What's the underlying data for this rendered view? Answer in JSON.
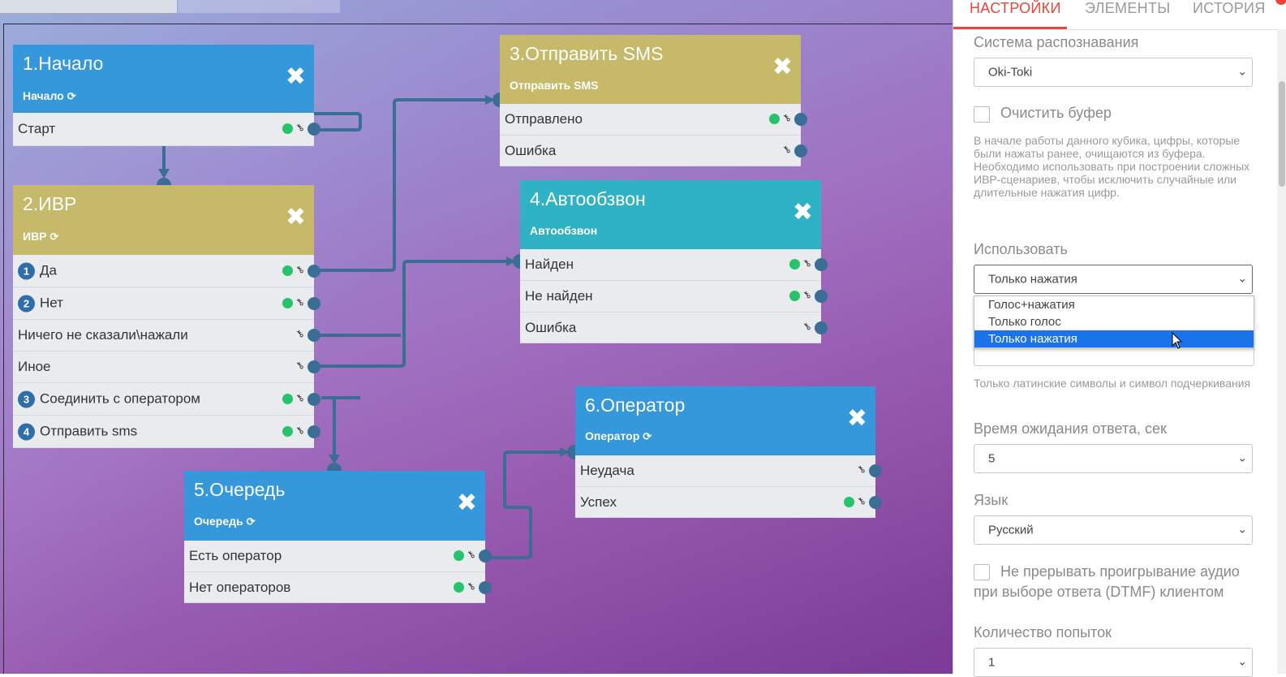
{
  "nodes": {
    "n1": {
      "title": "1.Начало",
      "subtitle": "Начало",
      "rows": [
        {
          "label": "Старт"
        }
      ]
    },
    "n2": {
      "title": "2.ИВР",
      "subtitle": "ИВР",
      "rows": [
        {
          "num": "1",
          "label": "Да"
        },
        {
          "num": "2",
          "label": "Нет"
        },
        {
          "label": "Ничего не сказали\\нажали"
        },
        {
          "label": "Иное"
        },
        {
          "num": "3",
          "label": "Соединить с оператором"
        },
        {
          "num": "4",
          "label": "Отправить sms"
        }
      ]
    },
    "n3": {
      "title": "3.Отправить SMS",
      "subtitle": "Отправить SMS",
      "rows": [
        {
          "label": "Отправлено"
        },
        {
          "label": "Ошибка"
        }
      ]
    },
    "n4": {
      "title": "4.Автообзвон",
      "subtitle": "Автообзвон",
      "rows": [
        {
          "label": "Найден"
        },
        {
          "label": "Не найден"
        },
        {
          "label": "Ошибка"
        }
      ]
    },
    "n5": {
      "title": "5.Очередь",
      "subtitle": "Очередь",
      "rows": [
        {
          "label": "Есть оператор"
        },
        {
          "label": "Нет операторов"
        }
      ]
    },
    "n6": {
      "title": "6.Оператор",
      "subtitle": "Оператор",
      "rows": [
        {
          "label": "Неудача"
        },
        {
          "label": "Успех"
        }
      ]
    }
  },
  "icons": {
    "close": "close-icon",
    "refresh": "refresh-icon",
    "key": "key-icon"
  },
  "colors": {
    "blue": "#3498db",
    "olive": "#c6b96a",
    "teal": "#2fb3c4",
    "wire": "#3b6e95",
    "accent": "#e8453c",
    "green_dot": "#27c36a"
  },
  "panel": {
    "tabs": [
      "НАСТРОЙКИ",
      "ЭЛЕМЕНТЫ",
      "ИСТОРИЯ"
    ],
    "recognition_label": "Система распознавания",
    "recognition_value": "Oki-Toki",
    "clear_buffer_label": "Очистить буфер",
    "clear_buffer_help": "В начале работы данного кубика, цифры, которые были нажаты ранее, очищаются из буфера. Необходимо использовать при построении сложных ИВР-сценариев, чтобы исключить случайные или длительные нажатия цифр.",
    "use_label": "Использовать",
    "use_value": "Только нажатия",
    "use_options": [
      "Голос+нажатия",
      "Только голос",
      "Только нажатия"
    ],
    "latin_help": "Только латинские символы и символ подчеркивания",
    "timeout_label": "Время ожидания ответа, сек",
    "timeout_value": "5",
    "language_label": "Язык",
    "language_value": "Русский",
    "no_interrupt_label": "Не прерывать проигрывание аудио при выборе ответа (DTMF) клиентом",
    "attempts_label": "Количество попыток",
    "attempts_value": "1"
  }
}
